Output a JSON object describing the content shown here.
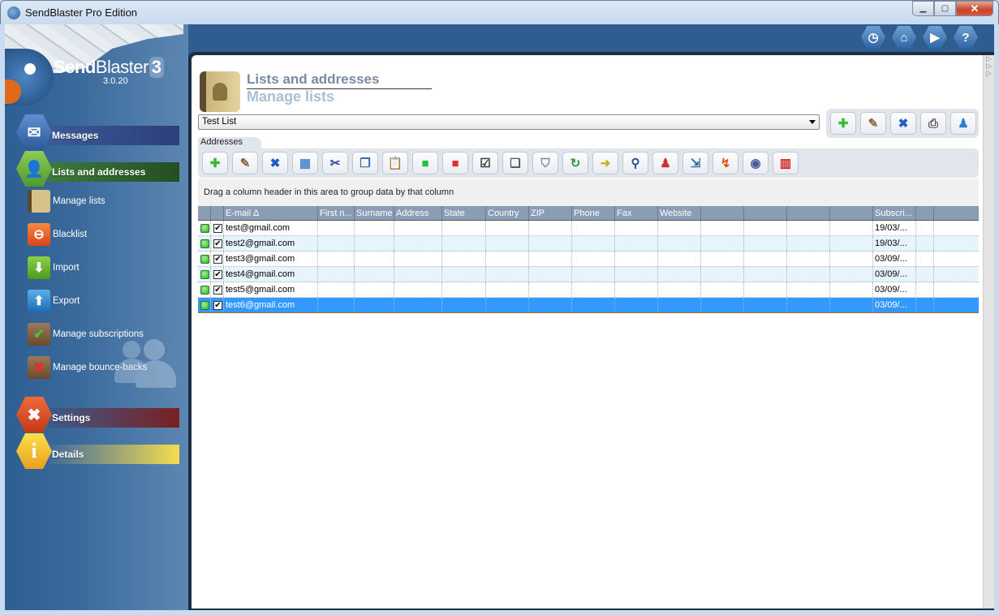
{
  "window": {
    "title": "SendBlaster Pro Edition",
    "min": "▁",
    "max": "▢",
    "close": "✕"
  },
  "brand": {
    "name_bold": "Send",
    "name_rest": "Blaster",
    "badge": "3",
    "version": "3.0.20"
  },
  "topbar_icons": [
    {
      "name": "history",
      "glyph": "◷"
    },
    {
      "name": "home",
      "glyph": "⌂"
    },
    {
      "name": "video",
      "glyph": "▶"
    },
    {
      "name": "help",
      "glyph": "?"
    }
  ],
  "sidebar": {
    "sections": [
      {
        "label": "Messages",
        "glyph": "✉"
      },
      {
        "label": "Lists and addresses",
        "glyph": "👤"
      },
      {
        "label": "Settings",
        "glyph": "✖"
      },
      {
        "label": "Details",
        "glyph": "i"
      }
    ],
    "items": [
      {
        "label": "Manage lists",
        "glyph": "▮"
      },
      {
        "label": "Blacklist",
        "glyph": "⊖"
      },
      {
        "label": "Import",
        "glyph": "⬇"
      },
      {
        "label": "Export",
        "glyph": "⬆"
      },
      {
        "label": "Manage subscriptions",
        "glyph": "✔"
      },
      {
        "label": "Manage bounce-backs",
        "glyph": "✖"
      }
    ]
  },
  "header": {
    "title": "Lists and addresses",
    "subtitle": "Manage lists"
  },
  "list_select": {
    "value": "Test List"
  },
  "list_tools": [
    {
      "name": "add",
      "glyph": "✚",
      "color": "#3cb83c"
    },
    {
      "name": "edit",
      "glyph": "✎",
      "color": "#8a6a3a"
    },
    {
      "name": "delete",
      "glyph": "✖",
      "color": "#1f5fbf"
    },
    {
      "name": "print",
      "glyph": "⎙",
      "color": "#555"
    },
    {
      "name": "merge",
      "glyph": "♟",
      "color": "#2d7fd0"
    }
  ],
  "tab": {
    "label": "Addresses"
  },
  "address_tools": [
    {
      "name": "add",
      "glyph": "✚",
      "color": "#3cb83c"
    },
    {
      "name": "edit",
      "glyph": "✎",
      "color": "#8a6a3a"
    },
    {
      "name": "delete",
      "glyph": "✖",
      "color": "#1f5fbf"
    },
    {
      "name": "select-all",
      "glyph": "▦",
      "color": "#4a8ad0"
    },
    {
      "name": "cut",
      "glyph": "✂",
      "color": "#2a4a9a"
    },
    {
      "name": "copy",
      "glyph": "❐",
      "color": "#3a6ab0"
    },
    {
      "name": "paste",
      "glyph": "📋",
      "color": "#c9a030"
    },
    {
      "name": "check-green",
      "glyph": "■",
      "color": "#22c040"
    },
    {
      "name": "check-red",
      "glyph": "■",
      "color": "#e03030"
    },
    {
      "name": "toggle-check",
      "glyph": "☑",
      "color": "#333"
    },
    {
      "name": "duplicate",
      "glyph": "❏",
      "color": "#555"
    },
    {
      "name": "filter",
      "glyph": "⛉",
      "color": "#888"
    },
    {
      "name": "verify",
      "glyph": "↻",
      "color": "#2a9a3a"
    },
    {
      "name": "move",
      "glyph": "➜",
      "color": "#d0b020"
    },
    {
      "name": "find",
      "glyph": "⚲",
      "color": "#2a4a9a"
    },
    {
      "name": "users",
      "glyph": "♟",
      "color": "#d03030"
    },
    {
      "name": "export-list",
      "glyph": "⇲",
      "color": "#2a6aa0"
    },
    {
      "name": "bounce",
      "glyph": "↯",
      "color": "#e05010"
    },
    {
      "name": "view",
      "glyph": "◉",
      "color": "#4a5a9a"
    },
    {
      "name": "columns",
      "glyph": "▥",
      "color": "#d02020"
    }
  ],
  "group_hint": "Drag a column header in this area to group data by that column",
  "grid": {
    "columns": [
      "",
      "",
      "E-mail ∆",
      "First n...",
      "Surname",
      "Address",
      "State",
      "Country",
      "ZIP",
      "Phone",
      "Fax",
      "Website",
      "",
      "",
      "",
      "",
      "Subscri...",
      ""
    ],
    "rows": [
      {
        "email": "test@gmail.com",
        "subscribed": "19/03/...",
        "checked": "✔"
      },
      {
        "email": "test2@gmail.com",
        "subscribed": "19/03/...",
        "checked": "✔"
      },
      {
        "email": "test3@gmail.com",
        "subscribed": "03/09/...",
        "checked": "✔"
      },
      {
        "email": "test4@gmail.com",
        "subscribed": "03/09/...",
        "checked": "✔"
      },
      {
        "email": "test5@gmail.com",
        "subscribed": "03/09/...",
        "checked": "✔"
      },
      {
        "email": "test6@gmail.com",
        "subscribed": "03/09/...",
        "checked": "✔"
      }
    ],
    "selected_row": 5
  },
  "colors": {
    "section_messages": "#2c3f7a",
    "section_lists": "#2c5a2a",
    "section_settings": "#7a2020",
    "section_details": "#f0d850",
    "selected_row": "#3399ff"
  }
}
